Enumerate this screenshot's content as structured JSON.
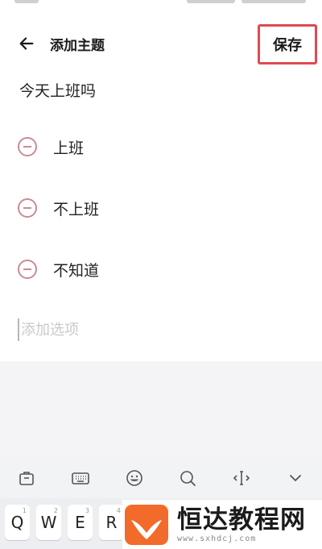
{
  "header": {
    "title": "添加主题",
    "save_label": "保存"
  },
  "question": "今天上班吗",
  "options": [
    {
      "label": "上班"
    },
    {
      "label": "不上班"
    },
    {
      "label": "不知道"
    }
  ],
  "add_option": {
    "placeholder": "添加选项"
  },
  "keyboard": {
    "toolbar_icons": [
      "clipboard-icon",
      "keyboard-icon",
      "emoji-icon",
      "search-icon",
      "cursor-move-icon",
      "chevron-down-icon"
    ],
    "keys": [
      {
        "label": "Q",
        "hint": "1"
      },
      {
        "label": "W",
        "hint": "2"
      },
      {
        "label": "E",
        "hint": "3"
      },
      {
        "label": "R",
        "hint": "4"
      }
    ]
  },
  "watermark": {
    "title": "恒达教程网",
    "url": "www.sxhdcj.com"
  },
  "colors": {
    "accent": "#e04a4f",
    "remove_icon": "#c98b96",
    "logo_orange": "#f26b2a"
  }
}
